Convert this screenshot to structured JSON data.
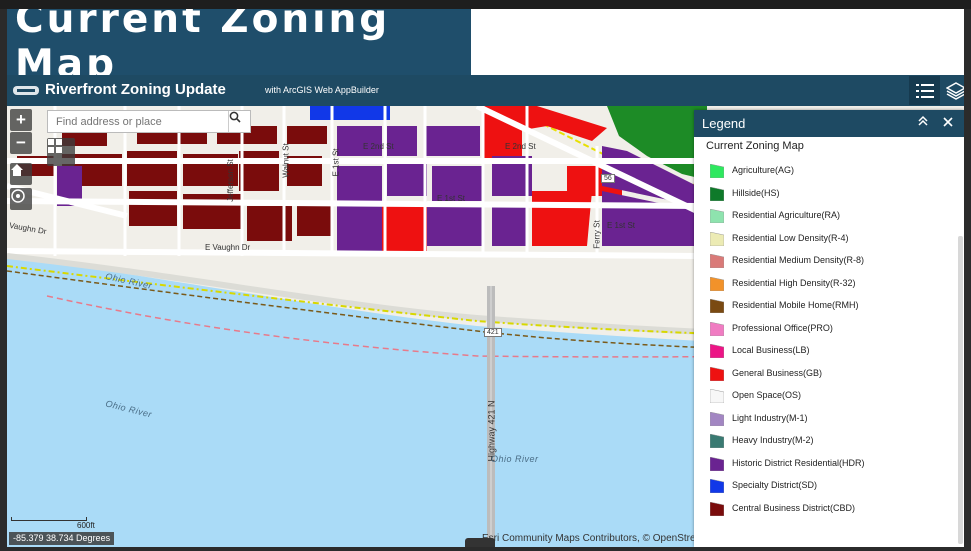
{
  "banner": {
    "title": "Current Zoning Map"
  },
  "header": {
    "app_title": "Riverfront Zoning Update",
    "app_subtitle": "with ArcGIS Web AppBuilder",
    "legend_icon": "list-icon",
    "layers_icon": "layers-icon"
  },
  "map_controls": {
    "zoom_in": "+",
    "zoom_out": "−",
    "home_icon": "home-icon",
    "locate_icon": "locate-icon",
    "basemap_icon": "grid-icon"
  },
  "search": {
    "placeholder": "Find address or place",
    "icon": "search-icon"
  },
  "map": {
    "street_labels": [
      "E 2nd St",
      "E 2nd St",
      "E 1st St",
      "E 1st St",
      "E Vaughn Dr",
      "Vaughn Dr",
      "Jefferson St",
      "Walnut St",
      "E 1st St",
      "Ferry St",
      "Highway 421 N",
      "56",
      "421"
    ],
    "river_labels": [
      "Ohio River",
      "Ohio River",
      "Ohio River"
    ],
    "scale": "600ft",
    "coordinates": "-85.379 38.734 Degrees",
    "attribution": "Esri Community Maps Contributors, © OpenStre"
  },
  "legend": {
    "title": "Legend",
    "layer_title": "Current Zoning Map",
    "items": [
      {
        "label": "Agriculture(AG)",
        "color": "#2ee85f"
      },
      {
        "label": "Hillside(HS)",
        "color": "#0e7a2a"
      },
      {
        "label": "Residential Agriculture(RA)",
        "color": "#8ee3ae"
      },
      {
        "label": "Residential Low Density(R-4)",
        "color": "#ecebb4"
      },
      {
        "label": "Residential Medium Density(R-8)",
        "color": "#d97a78"
      },
      {
        "label": "Residential High Density(R-32)",
        "color": "#f2922a"
      },
      {
        "label": "Residential Mobile Home(RMH)",
        "color": "#7a4a12"
      },
      {
        "label": "Professional Office(PRO)",
        "color": "#f07cc2"
      },
      {
        "label": "Local Business(LB)",
        "color": "#ec1586"
      },
      {
        "label": "General Business(GB)",
        "color": "#ee1111"
      },
      {
        "label": "Open Space(OS)",
        "color": "#f7f7f7"
      },
      {
        "label": "Light Industry(M-1)",
        "color": "#a286c2"
      },
      {
        "label": "Heavy Industry(M-2)",
        "color": "#3a7a72"
      },
      {
        "label": "Historic District Residential(HDR)",
        "color": "#6a2391"
      },
      {
        "label": "Specialty District(SD)",
        "color": "#1138e8"
      },
      {
        "label": "Central Business District(CBD)",
        "color": "#7a0c0c"
      }
    ]
  }
}
